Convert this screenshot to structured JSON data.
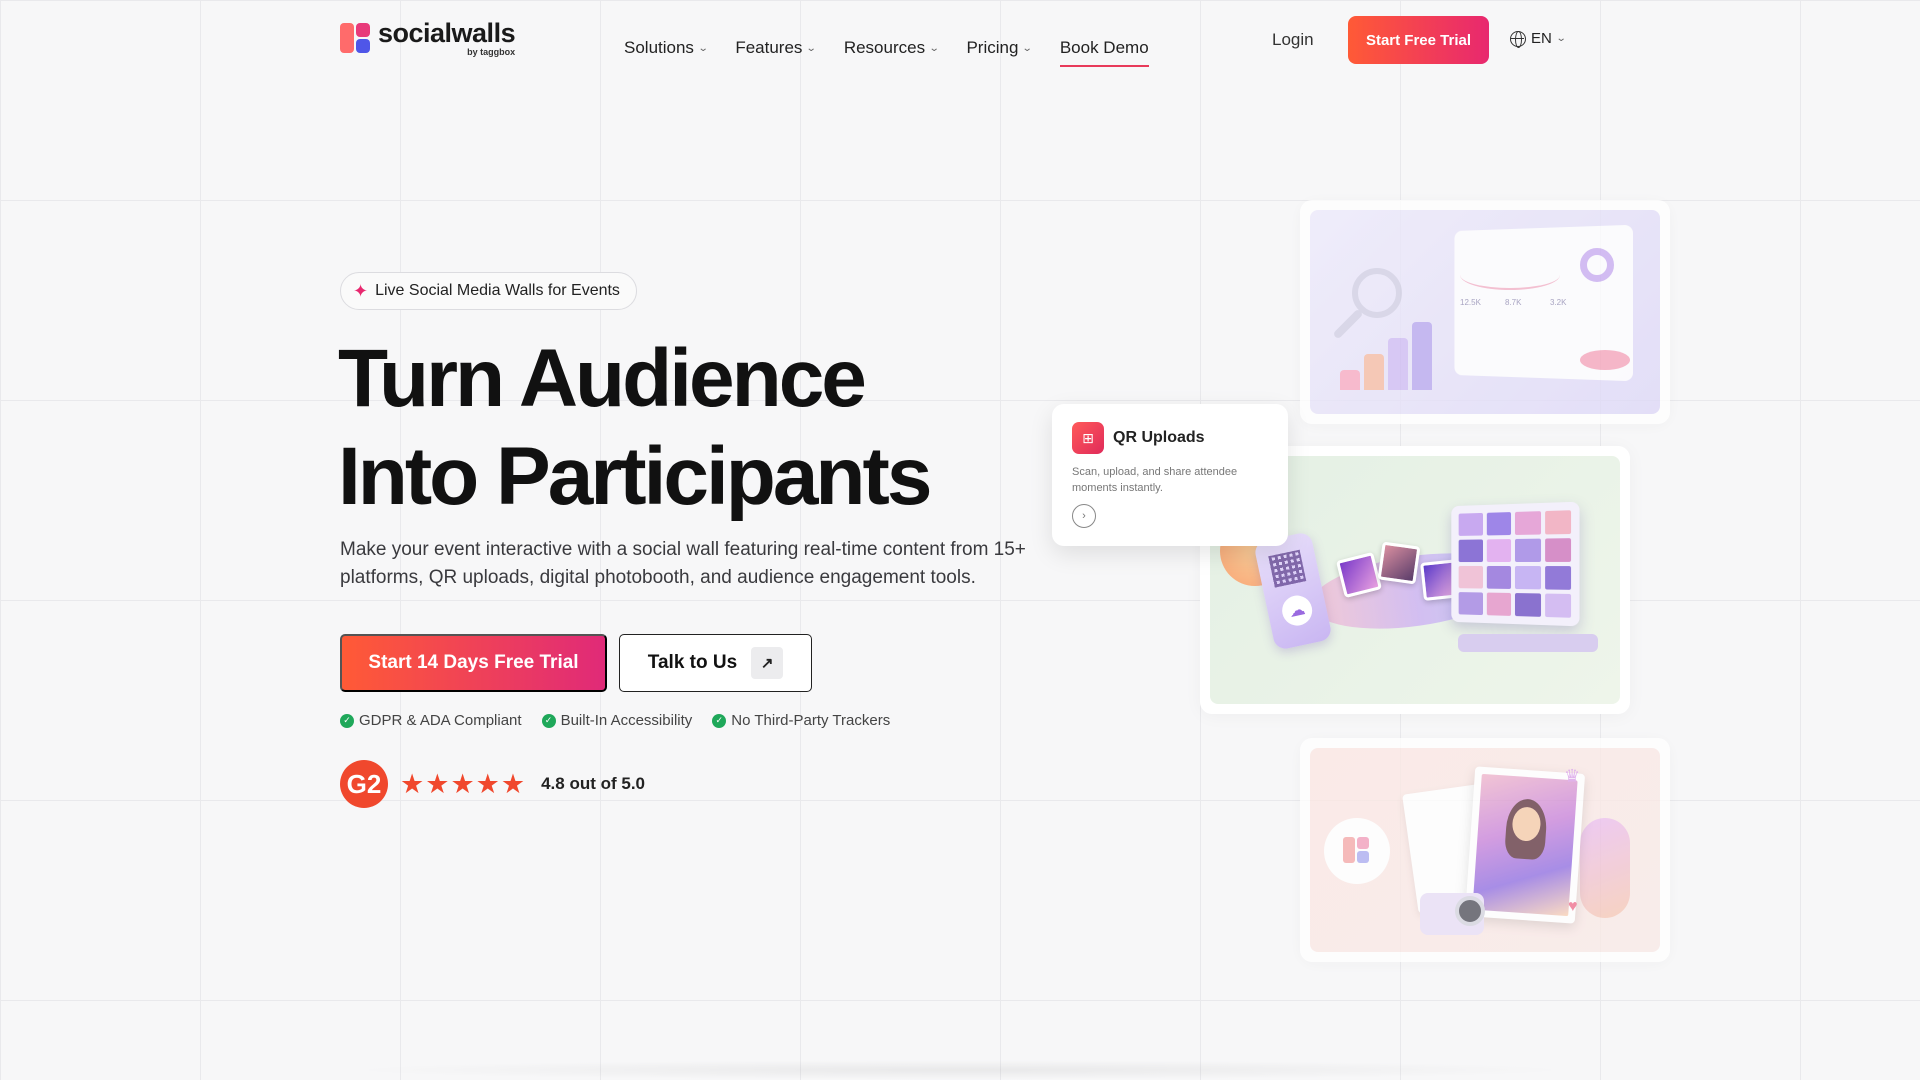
{
  "nav": {
    "logo_name": "socialwalls",
    "logo_by": "by taggbox",
    "items": [
      {
        "label": "Solutions",
        "has_dropdown": true
      },
      {
        "label": "Features",
        "has_dropdown": true
      },
      {
        "label": "Resources",
        "has_dropdown": true
      },
      {
        "label": "Pricing",
        "has_dropdown": true
      },
      {
        "label": "Book Demo",
        "has_dropdown": false,
        "active": true
      }
    ],
    "login": "Login",
    "cta": "Start Free Trial",
    "language": "EN"
  },
  "hero": {
    "badge": "Live Social Media Walls for Events",
    "headline_line1": "Turn Audience",
    "headline_line2": "Into Participants",
    "description": "Make your event interactive with a social wall featuring real-time content from 15+ platforms, QR uploads, digital photobooth, and audience engagement tools.",
    "primary_cta": "Start 14 Days Free Trial",
    "secondary_cta": "Talk to Us",
    "compliance": [
      "GDPR & ADA Compliant",
      "Built-In Accessibility",
      "No Third-Party Trackers"
    ],
    "rating_badge": "G2",
    "rating_stars": 5,
    "rating_text": "4.8 out of 5.0"
  },
  "qr_card": {
    "title": "QR Uploads",
    "description": "Scan, upload, and share attendee moments instantly."
  },
  "dashboard": {
    "stats": [
      "12.5K",
      "8.7K",
      "3.2K"
    ]
  },
  "colors": {
    "brand_gradient_start": "#ff5a36",
    "brand_gradient_end": "#e8286f",
    "accent_green": "#1fa85a",
    "g2_red": "#f0482d"
  }
}
